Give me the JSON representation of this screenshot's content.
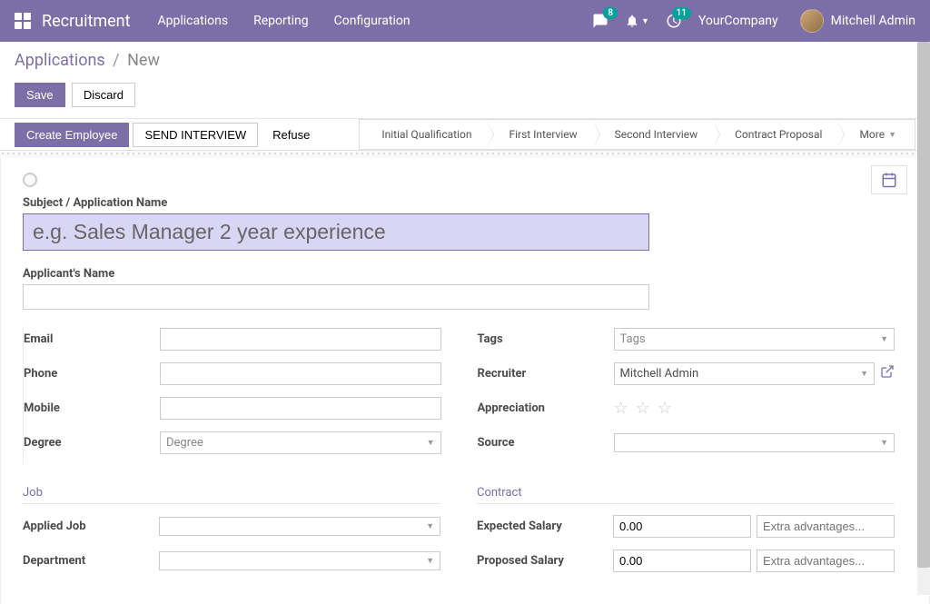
{
  "topnav": {
    "brand": "Recruitment",
    "menu": [
      "Applications",
      "Reporting",
      "Configuration"
    ],
    "messaging_badge": "8",
    "activities_badge": "11",
    "company": "YourCompany",
    "user": "Mitchell Admin"
  },
  "breadcrumb": {
    "parent": "Applications",
    "current": "New"
  },
  "actions": {
    "save": "Save",
    "discard": "Discard"
  },
  "status_buttons": {
    "create_employee": "Create Employee",
    "send_interview": "SEND INTERVIEW",
    "refuse": "Refuse"
  },
  "stages": [
    "Initial Qualification",
    "First Interview",
    "Second Interview",
    "Contract Proposal",
    "More"
  ],
  "form": {
    "subject_label": "Subject / Application Name",
    "subject_placeholder": "e.g. Sales Manager 2 year experience",
    "subject_value": "",
    "applicant_label": "Applicant's Name",
    "applicant_value": "",
    "left": {
      "email": {
        "label": "Email",
        "value": ""
      },
      "phone": {
        "label": "Phone",
        "value": ""
      },
      "mobile": {
        "label": "Mobile",
        "value": ""
      },
      "degree": {
        "label": "Degree",
        "placeholder": "Degree",
        "value": ""
      }
    },
    "right": {
      "tags": {
        "label": "Tags",
        "placeholder": "Tags",
        "value": ""
      },
      "recruiter": {
        "label": "Recruiter",
        "value": "Mitchell Admin"
      },
      "appreciation": {
        "label": "Appreciation"
      },
      "source": {
        "label": "Source",
        "value": ""
      }
    },
    "job_section": "Job",
    "job": {
      "applied_job": {
        "label": "Applied Job",
        "value": ""
      },
      "department": {
        "label": "Department",
        "value": ""
      }
    },
    "contract_section": "Contract",
    "contract": {
      "expected_salary": {
        "label": "Expected Salary",
        "value": "0.00",
        "extra_placeholder": "Extra advantages..."
      },
      "proposed_salary": {
        "label": "Proposed Salary",
        "value": "0.00",
        "extra_placeholder": "Extra advantages..."
      }
    }
  }
}
